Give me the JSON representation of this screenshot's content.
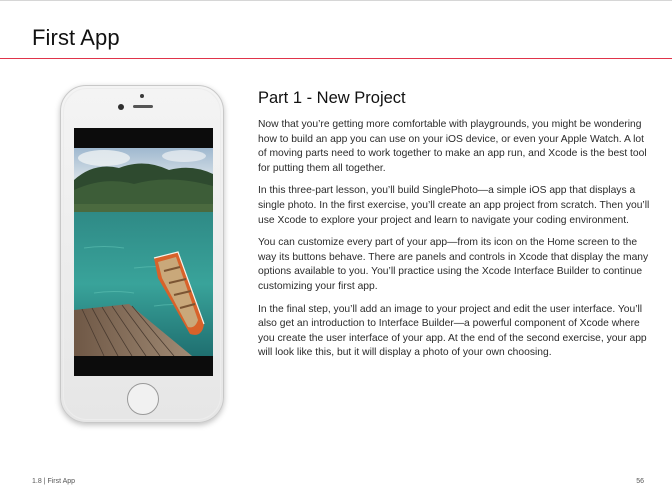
{
  "header": {
    "chapter_title": "First App"
  },
  "phone": {
    "screen_image": "boat-on-lake-photo"
  },
  "content": {
    "heading": "Part 1 - New Project",
    "paragraphs": [
      "Now that you’re getting more comfortable with playgrounds, you might be wondering how to build an app you can use on your iOS device, or even your Apple Watch. A lot of moving parts need to work together to make an app run, and Xcode is the best tool for putting them all together.",
      "In this three-part lesson, you’ll build SinglePhoto—a simple iOS app that displays a single photo. In the first exercise, you’ll create an app project from scratch. Then you’ll use Xcode to explore your project and learn to navigate your coding environment.",
      "You can customize every part of your app—from its icon on the Home screen to the way its buttons behave. There are panels and controls in Xcode that display the many options available to you. You’ll practice using the Xcode Interface Builder to continue customizing your first app.",
      "In the final step, you’ll add an image to your project and edit the user interface. You’ll also get an introduction to Interface Builder—a powerful component of Xcode where you create the user interface of your app. At the end of the second exercise, your app will look like this, but it will display a photo of your own choosing."
    ]
  },
  "footer": {
    "section_label": "1.8  |  First App",
    "page_number": "56"
  },
  "colors": {
    "accent_rule": "#e0344a"
  }
}
